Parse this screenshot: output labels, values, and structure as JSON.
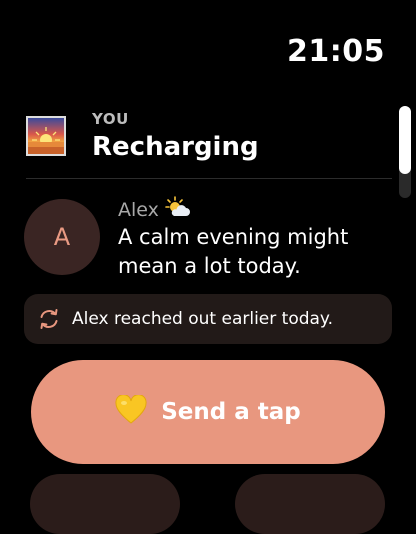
{
  "status_bar": {
    "time": "21:05"
  },
  "you": {
    "label": "YOU",
    "status": "Recharging",
    "thumbnail_icon": "sunset-icon"
  },
  "friend": {
    "avatar_letter": "A",
    "name": "Alex",
    "weather_icon": "sun-behind-cloud-icon",
    "message": "A calm evening might mean a lot today."
  },
  "notice": {
    "icon": "sync-arrows-icon",
    "text": "Alex reached out earlier today."
  },
  "actions": {
    "send_tap": {
      "icon": "yellow-heart-icon",
      "label": "Send a tap"
    }
  },
  "colors": {
    "background": "#000000",
    "accent": "#e8977f",
    "avatar_bg": "#3a2523",
    "avatar_fg": "#e99a83",
    "notice_bg": "#221a18"
  }
}
